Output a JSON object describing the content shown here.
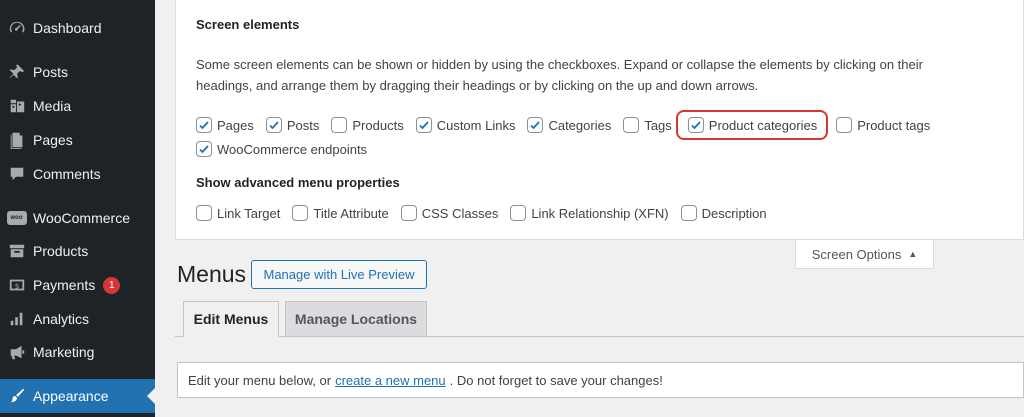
{
  "sidebar": {
    "items": [
      {
        "label": "Dashboard",
        "icon": "dashboard-icon"
      },
      {
        "label": "Posts",
        "icon": "pin-icon"
      },
      {
        "label": "Media",
        "icon": "media-icon"
      },
      {
        "label": "Pages",
        "icon": "pages-icon"
      },
      {
        "label": "Comments",
        "icon": "comment-icon"
      },
      {
        "label": "WooCommerce",
        "icon": "woo-icon",
        "icon_text": "woo"
      },
      {
        "label": "Products",
        "icon": "archive-icon"
      },
      {
        "label": "Payments",
        "icon": "dollar-icon",
        "badge": "1"
      },
      {
        "label": "Analytics",
        "icon": "bar-chart-icon"
      },
      {
        "label": "Marketing",
        "icon": "megaphone-icon"
      },
      {
        "label": "Appearance",
        "icon": "brush-icon",
        "active": true
      }
    ],
    "colors": {
      "bg": "#1d2327",
      "active": "#2271b1",
      "badge": "#d63638"
    }
  },
  "screen_options": {
    "heading": "Screen elements",
    "description": "Some screen elements can be shown or hidden by using the checkboxes. Expand or collapse the elements by clicking on their headings, and arrange them by dragging their headings or by clicking on the up and down arrows.",
    "elements": [
      {
        "label": "Pages",
        "checked": true
      },
      {
        "label": "Posts",
        "checked": true
      },
      {
        "label": "Products",
        "checked": false
      },
      {
        "label": "Custom Links",
        "checked": true
      },
      {
        "label": "Categories",
        "checked": true
      },
      {
        "label": "Tags",
        "checked": false
      },
      {
        "label": "Product categories",
        "checked": true,
        "highlighted": true
      },
      {
        "label": "Product tags",
        "checked": false
      },
      {
        "label": "WooCommerce endpoints",
        "checked": true
      }
    ],
    "advanced_heading": "Show advanced menu properties",
    "advanced": [
      {
        "label": "Link Target",
        "checked": false
      },
      {
        "label": "Title Attribute",
        "checked": false
      },
      {
        "label": "CSS Classes",
        "checked": false
      },
      {
        "label": "Link Relationship (XFN)",
        "checked": false
      },
      {
        "label": "Description",
        "checked": false
      }
    ],
    "tab_label": "Screen Options",
    "tab_arrow": "▲",
    "highlight_color": "#d63638"
  },
  "main": {
    "title": "Menus",
    "live_preview_button": "Manage with Live Preview",
    "tabs": [
      {
        "label": "Edit Menus",
        "active": true
      },
      {
        "label": "Manage Locations",
        "active": false
      }
    ],
    "notice": {
      "before": "Edit your menu below, or",
      "link": "create a new menu",
      "after": ". Do not forget to save your changes!"
    },
    "accent": "#2271b1"
  }
}
